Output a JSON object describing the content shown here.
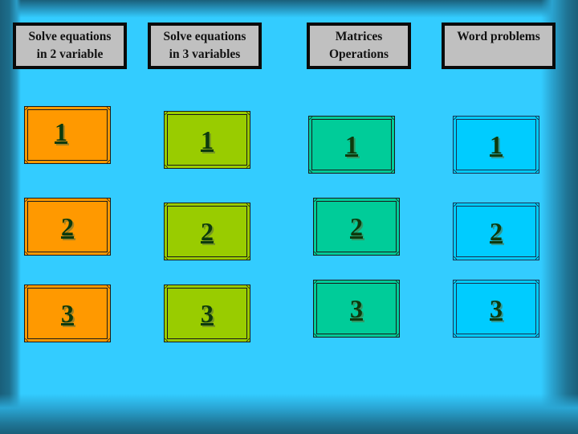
{
  "slide": {
    "background_color": "#33ccff",
    "frame_shadow_color": "#1a5f7a"
  },
  "categories": [
    {
      "label": "Solve equations\nin 2 variable",
      "tile_color": "#ff9900",
      "questions": [
        "1",
        "2",
        "3"
      ]
    },
    {
      "label": "Solve equations\nin 3 variables",
      "tile_color": "#99cc00",
      "questions": [
        "1",
        "2",
        "3"
      ]
    },
    {
      "label": "Matrices\nOperations",
      "tile_color": "#00cc99",
      "questions": [
        "1",
        "2",
        "3"
      ]
    },
    {
      "label": "Word problems",
      "tile_color": "#00ccff",
      "questions": [
        "1",
        "2",
        "3"
      ]
    }
  ],
  "header_box_color": "#c0c0c0",
  "number_color": "#0d3a0d"
}
